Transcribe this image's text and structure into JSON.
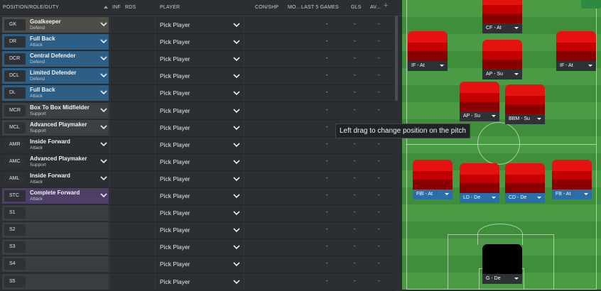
{
  "header": {
    "position_role_duty": "POSITION/ROLE/DUTY",
    "inf": "INF",
    "rds": "RDS",
    "player": "PLAYER",
    "con_shp": "CON/SHP",
    "mo": "MO...",
    "last5": "LAST 5 GAMES",
    "gls": "GLS",
    "av": "AV...",
    "add": "+"
  },
  "rows": [
    {
      "code": "GK",
      "role": "Goalkeeper",
      "duty": "Defend",
      "player": "Pick Player",
      "v1": "-",
      "v2": "-",
      "v3": "-",
      "color": "#4d4e45"
    },
    {
      "code": "DR",
      "role": "Full Back",
      "duty": "Attack",
      "player": "Pick Player",
      "v1": "-",
      "v2": "-",
      "v3": "-",
      "color": "#2d5f86"
    },
    {
      "code": "DCR",
      "role": "Central Defender",
      "duty": "Defend",
      "player": "Pick Player",
      "v1": "-",
      "v2": "-",
      "v3": "-",
      "color": "#2d5f86"
    },
    {
      "code": "DCL",
      "role": "Limited Defender",
      "duty": "Defend",
      "player": "Pick Player",
      "v1": "-",
      "v2": "-",
      "v3": "-",
      "color": "#2d5f86"
    },
    {
      "code": "DL",
      "role": "Full Back",
      "duty": "Attack",
      "player": "Pick Player",
      "v1": "-",
      "v2": "-",
      "v3": "-",
      "color": "#2d5f86"
    },
    {
      "code": "MCR",
      "role": "Box To Box Midfielder",
      "duty": "Support",
      "player": "Pick Player",
      "v1": "-",
      "v2": "-",
      "v3": "-",
      "color": "#3d4146"
    },
    {
      "code": "MCL",
      "role": "Advanced Playmaker",
      "duty": "Support",
      "player": "Pick Player",
      "v1": "-",
      "v2": "-",
      "v3": "-",
      "color": "#3d4146"
    },
    {
      "code": "AMR",
      "role": "Inside Forward",
      "duty": "Attack",
      "player": "Pick Player",
      "v1": "-",
      "v2": "-",
      "v3": "-",
      "color": "#2b2e33"
    },
    {
      "code": "AMC",
      "role": "Advanced Playmaker",
      "duty": "Support",
      "player": "Pick Player",
      "v1": "-",
      "v2": "-",
      "v3": "-",
      "color": "#2b2e33"
    },
    {
      "code": "AML",
      "role": "Inside Forward",
      "duty": "Attack",
      "player": "Pick Player",
      "v1": "-",
      "v2": "-",
      "v3": "-",
      "color": "#2b2e33"
    },
    {
      "code": "STC",
      "role": "Complete Forward",
      "duty": "Attack",
      "player": "Pick Player",
      "v1": "-",
      "v2": "-",
      "v3": "-",
      "color": "#4d3f66"
    },
    {
      "code": "S1",
      "role": "",
      "duty": "",
      "player": "Pick Player",
      "v1": "-",
      "v2": "-",
      "v3": "-",
      "color": "#3a3d42"
    },
    {
      "code": "S2",
      "role": "",
      "duty": "",
      "player": "Pick Player",
      "v1": "-",
      "v2": "-",
      "v3": "-",
      "color": "#3a3d42"
    },
    {
      "code": "S3",
      "role": "",
      "duty": "",
      "player": "Pick Player",
      "v1": "-",
      "v2": "-",
      "v3": "-",
      "color": "#3a3d42"
    },
    {
      "code": "S4",
      "role": "",
      "duty": "",
      "player": "Pick Player",
      "v1": "-",
      "v2": "-",
      "v3": "-",
      "color": "#3a3d42"
    },
    {
      "code": "S5",
      "role": "",
      "duty": "",
      "player": "Pick Player",
      "v1": "-",
      "v2": "-",
      "v3": "-",
      "color": "#3a3d42"
    }
  ],
  "pitch": {
    "players": [
      {
        "label": "CF - At",
        "style": "dark"
      },
      {
        "label": "IF - At",
        "style": "dark"
      },
      {
        "label": "AP - Su",
        "style": "dark"
      },
      {
        "label": "IF - At",
        "style": "dark"
      },
      {
        "label": "AP - Su",
        "style": "dark"
      },
      {
        "label": "BBM - Su",
        "style": "dark"
      },
      {
        "label": "FBl - At",
        "style": "blue"
      },
      {
        "label": "LD - De",
        "style": "blue"
      },
      {
        "label": "CD - De",
        "style": "blue"
      },
      {
        "label": "FB - At",
        "style": "blue"
      },
      {
        "label": "G - De",
        "style": "dark"
      }
    ],
    "tooltip": "Left drag to change position on the pitch"
  }
}
